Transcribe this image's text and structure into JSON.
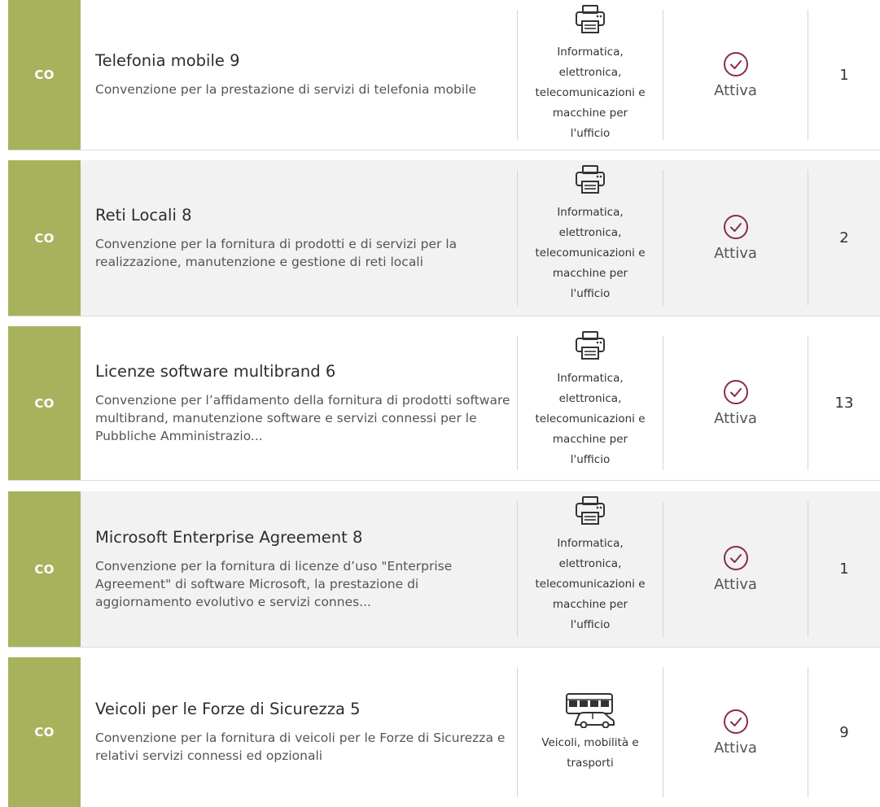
{
  "rows": [
    {
      "badge": "CO",
      "title": "Telefonia mobile 9",
      "description": "Convenzione per la prestazione di servizi di telefonia mobile",
      "category": {
        "icon": "printer-icon",
        "lines": [
          "Informatica,",
          "elettronica,",
          "telecomunicazioni e",
          "macchine per",
          "l'ufficio"
        ]
      },
      "status": "Attiva",
      "count": "1"
    },
    {
      "badge": "CO",
      "title": "Reti Locali 8",
      "description": "Convenzione per la fornitura di prodotti e di servizi per la realizzazione, manutenzione e gestione di reti locali",
      "category": {
        "icon": "printer-icon",
        "lines": [
          "Informatica,",
          "elettronica,",
          "telecomunicazioni e",
          "macchine per",
          "l'ufficio"
        ]
      },
      "status": "Attiva",
      "count": "2"
    },
    {
      "badge": "CO",
      "title": "Licenze software multibrand 6",
      "description": "Convenzione per l’affidamento della fornitura di prodotti software multibrand, manutenzione software e servizi connessi per le Pubbliche Amministrazio...",
      "category": {
        "icon": "printer-icon",
        "lines": [
          "Informatica,",
          "elettronica,",
          "telecomunicazioni e",
          "macchine per",
          "l'ufficio"
        ]
      },
      "status": "Attiva",
      "count": "13"
    },
    {
      "badge": "CO",
      "title": "Microsoft Enterprise Agreement 8",
      "description": "Convenzione per la fornitura di licenze d’uso \"Enterprise Agreement\" di software Microsoft, la prestazione di aggiornamento evolutivo e servizi connes...",
      "category": {
        "icon": "printer-icon",
        "lines": [
          "Informatica,",
          "elettronica,",
          "telecomunicazioni e",
          "macchine per",
          "l'ufficio"
        ]
      },
      "status": "Attiva",
      "count": "1"
    },
    {
      "badge": "CO",
      "title": "Veicoli per le Forze di Sicurezza 5",
      "description": "Convenzione per la fornitura di veicoli per le Forze di Sicurezza e relativi servizi connessi ed opzionali",
      "category": {
        "icon": "vehicles-icon",
        "lines": [
          "Veicoli, mobilità e",
          "trasporti"
        ]
      },
      "status": "Attiva",
      "count": "9"
    }
  ],
  "colors": {
    "badge": "#a8b25c",
    "status_icon": "#8a2a4f",
    "alt_row": "#f2f2f2"
  }
}
